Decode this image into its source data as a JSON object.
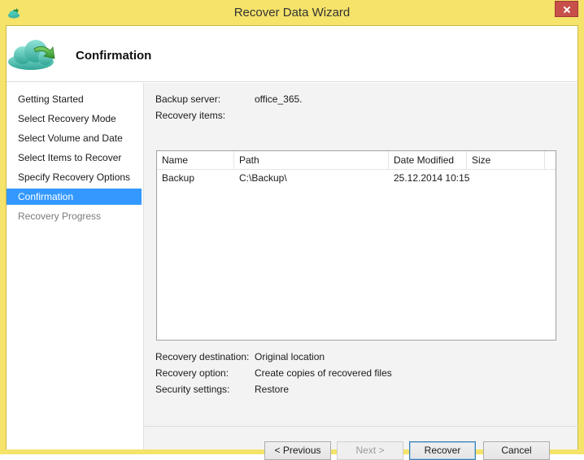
{
  "window": {
    "title": "Recover Data Wizard",
    "accent_color": "#f5e36a",
    "icons": {
      "app": "cloud-icon",
      "close": "close-icon",
      "header": "cloud-recover-icon"
    }
  },
  "header": {
    "title": "Confirmation"
  },
  "sidebar": {
    "steps": [
      {
        "label": "Getting Started",
        "state": "done"
      },
      {
        "label": "Select Recovery Mode",
        "state": "done"
      },
      {
        "label": "Select Volume and Date",
        "state": "done"
      },
      {
        "label": "Select Items to Recover",
        "state": "done"
      },
      {
        "label": "Specify Recovery Options",
        "state": "done"
      },
      {
        "label": "Confirmation",
        "state": "active"
      },
      {
        "label": "Recovery Progress",
        "state": "disabled"
      }
    ],
    "active_color": "#3399ff"
  },
  "summary": {
    "backup_server_label": "Backup server:",
    "backup_server_value": "office_365.",
    "recovery_items_label": "Recovery items:",
    "recovery_destination_label": "Recovery destination:",
    "recovery_destination_value": "Original location",
    "recovery_option_label": "Recovery option:",
    "recovery_option_value": "Create copies of recovered files",
    "security_settings_label": "Security settings:",
    "security_settings_value": "Restore"
  },
  "items_table": {
    "columns": [
      "Name",
      "Path",
      "Date Modified",
      "Size"
    ],
    "rows": [
      {
        "name": "Backup",
        "path": "C:\\Backup\\",
        "date_modified": "25.12.2014 10:15",
        "size": ""
      }
    ]
  },
  "buttons": {
    "previous": "< Previous",
    "next": "Next >",
    "recover": "Recover",
    "cancel": "Cancel"
  }
}
